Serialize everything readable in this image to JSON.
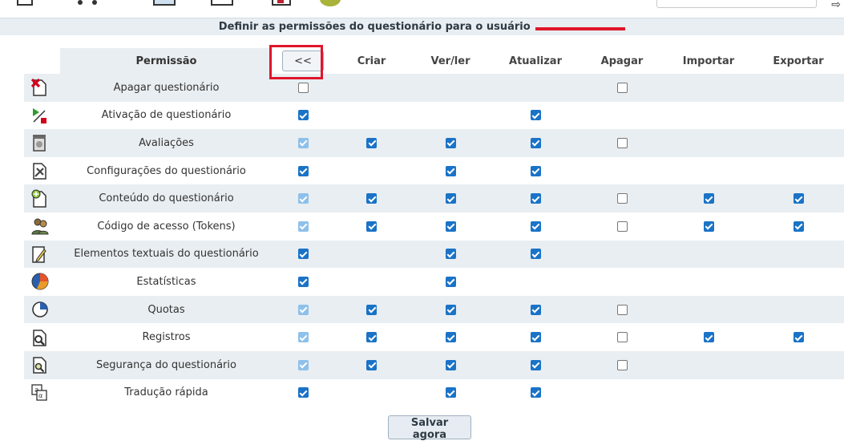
{
  "header": {
    "title": "Definir as permissões do questionário para o usuário"
  },
  "columns": {
    "permission": "Permissão",
    "toggle": "<<",
    "create": "Criar",
    "read": "Ver/ler",
    "update": "Atualizar",
    "delete": "Apagar",
    "import": "Importar",
    "export": "Exportar"
  },
  "rows": [
    {
      "icon": "delete-survey-icon",
      "label": "Apagar questionário",
      "all": "off",
      "create": "",
      "read": "",
      "update": "",
      "delete": "off",
      "import": "",
      "export": ""
    },
    {
      "icon": "activate-survey-icon",
      "label": "Ativação de questionário",
      "all": "on",
      "create": "",
      "read": "",
      "update": "on",
      "delete": "",
      "import": "",
      "export": ""
    },
    {
      "icon": "assessments-icon",
      "label": "Avaliações",
      "all": "dis",
      "create": "on",
      "read": "on",
      "update": "on",
      "delete": "off",
      "import": "",
      "export": ""
    },
    {
      "icon": "survey-settings-icon",
      "label": "Configurações do questionário",
      "all": "on",
      "create": "",
      "read": "on",
      "update": "on",
      "delete": "",
      "import": "",
      "export": ""
    },
    {
      "icon": "survey-content-icon",
      "label": "Conteúdo do questionário",
      "all": "dis",
      "create": "on",
      "read": "on",
      "update": "on",
      "delete": "off",
      "import": "on",
      "export": "on"
    },
    {
      "icon": "tokens-icon",
      "label": "Código de acesso (Tokens)",
      "all": "dis",
      "create": "on",
      "read": "on",
      "update": "on",
      "delete": "off",
      "import": "on",
      "export": "on"
    },
    {
      "icon": "text-elements-icon",
      "label": "Elementos textuais do questionário",
      "all": "on",
      "create": "",
      "read": "on",
      "update": "on",
      "delete": "",
      "import": "",
      "export": ""
    },
    {
      "icon": "statistics-icon",
      "label": "Estatísticas",
      "all": "on",
      "create": "",
      "read": "on",
      "update": "",
      "delete": "",
      "import": "",
      "export": ""
    },
    {
      "icon": "quotas-icon",
      "label": "Quotas",
      "all": "dis",
      "create": "on",
      "read": "on",
      "update": "on",
      "delete": "off",
      "import": "",
      "export": ""
    },
    {
      "icon": "responses-icon",
      "label": "Registros",
      "all": "dis",
      "create": "on",
      "read": "on",
      "update": "on",
      "delete": "off",
      "import": "on",
      "export": "on"
    },
    {
      "icon": "survey-security-icon",
      "label": "Segurança do questionário",
      "all": "dis",
      "create": "on",
      "read": "on",
      "update": "on",
      "delete": "off",
      "import": "",
      "export": ""
    },
    {
      "icon": "quick-translation-icon",
      "label": "Tradução rápida",
      "all": "on",
      "create": "",
      "read": "on",
      "update": "on",
      "delete": "",
      "import": "",
      "export": ""
    }
  ],
  "save_label": "Salvar agora",
  "colors": {
    "accent": "#1a73c7",
    "row_stripe": "#e9eef2",
    "highlight": "#e0162b"
  }
}
